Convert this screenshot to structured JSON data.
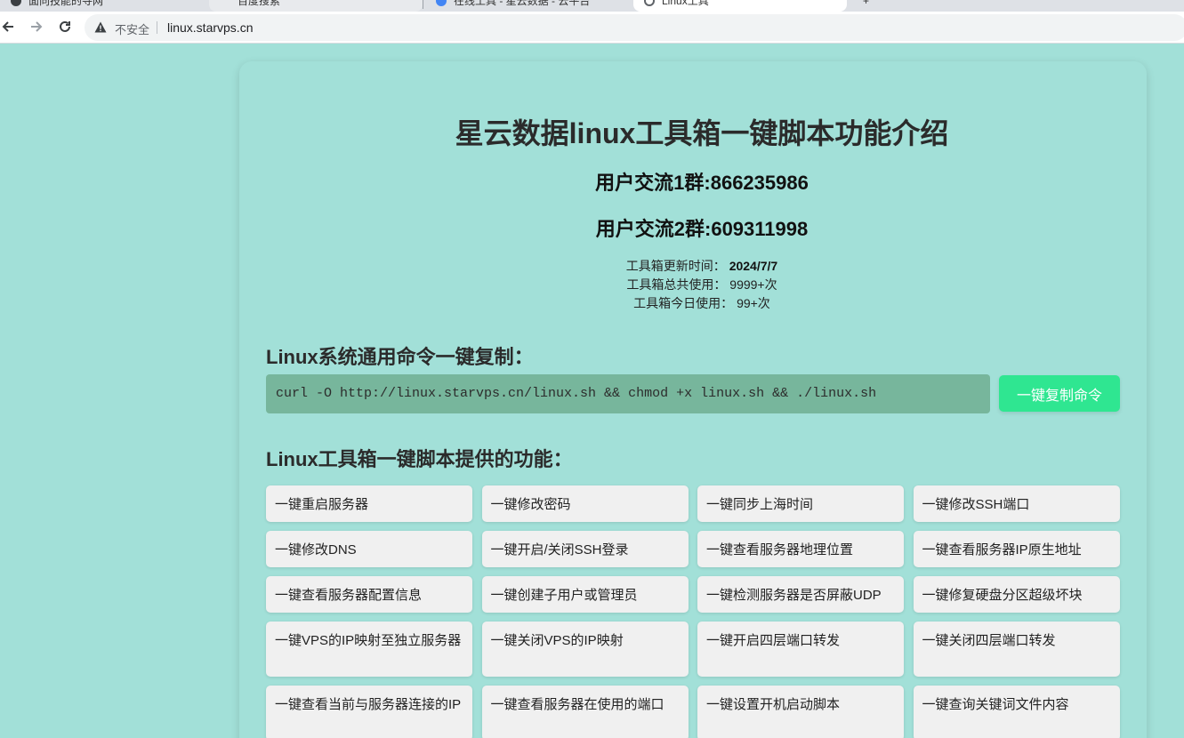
{
  "browser": {
    "tabs": [
      {
        "label": "面向技能的寻网",
        "active": false
      },
      {
        "label": "百度搜索",
        "active": false
      },
      {
        "label": "在线工具 - 星云数据 - 云平台",
        "active": false
      },
      {
        "label": "Linux工具",
        "active": true
      }
    ],
    "security_label": "不安全",
    "url": "linux.starvps.cn"
  },
  "page": {
    "title": "星云数据linux工具箱一键脚本功能介绍",
    "group1": "用户交流1群:866235986",
    "group2": "用户交流2群:609311998",
    "stats": {
      "updated_label": "工具箱更新时间：",
      "updated_value": "2024/7/7",
      "total_label": "工具箱总共使用：",
      "total_value": "9999+次",
      "today_label": "工具箱今日使用：",
      "today_value": "99+次"
    },
    "copy_section_title": "Linux系统通用命令一键复制：",
    "command": "curl -O http://linux.starvps.cn/linux.sh && chmod +x linux.sh && ./linux.sh",
    "copy_button": "一键复制命令",
    "features_title": "Linux工具箱一键脚本提供的功能：",
    "features": [
      "一键重启服务器",
      "一键修改密码",
      "一键同步上海时间",
      "一键修改SSH端口",
      "一键修改DNS",
      "一键开启/关闭SSH登录",
      "一键查看服务器地理位置",
      "一键查看服务器IP原生地址",
      "一键查看服务器配置信息",
      "一键创建子用户或管理员",
      "一键检测服务器是否屏蔽UDP",
      "一键修复硬盘分区超级坏块",
      "一键VPS的IP映射至独立服务器",
      "一键关闭VPS的IP映射",
      "一键开启四层端口转发",
      "一键关闭四层端口转发",
      "一键查看当前与服务器连接的IP",
      "一键查看服务器在使用的端口",
      "一键设置开机启动脚本",
      "一键查询关键词文件内容"
    ]
  },
  "colors": {
    "page_bg": "#a2e0d8",
    "command_bg": "#77b69c",
    "copy_button_bg": "#2fe691",
    "feature_bg": "#f0f0f0"
  }
}
